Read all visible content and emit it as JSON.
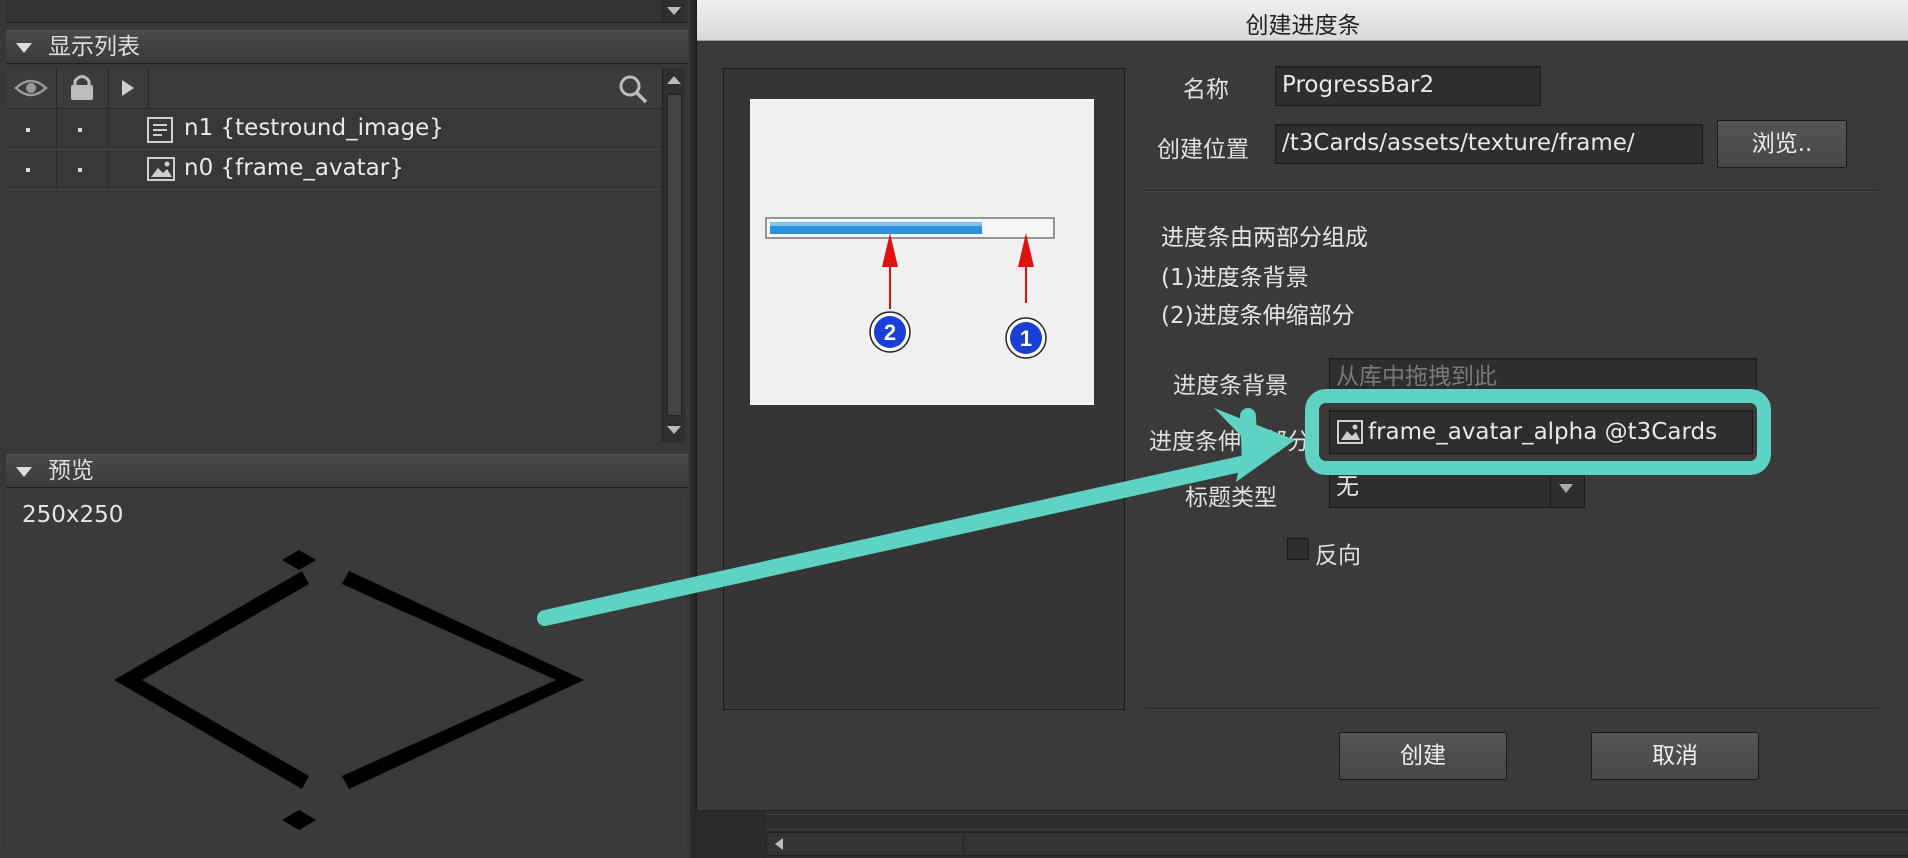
{
  "display_list": {
    "header": "显示列表",
    "rows": [
      {
        "name": "n1 {testround_image}",
        "icon": "text-icon"
      },
      {
        "name": "n0 {frame_avatar}",
        "icon": "image-icon"
      }
    ]
  },
  "preview_panel": {
    "header": "预览",
    "size_label": "250x250"
  },
  "dialog": {
    "title": "创建进度条",
    "name_label": "名称",
    "name_value": "ProgressBar2",
    "location_label": "创建位置",
    "location_value": "/t3Cards/assets/texture/frame/",
    "browse_button": "浏览..",
    "desc_line1": "进度条由两部分组成",
    "desc_line2": "(1)进度条背景",
    "desc_line3": "(2)进度条伸缩部分",
    "bg_label": "进度条背景",
    "bg_placeholder": "从库中拖拽到此",
    "stretch_label": "进度条伸缩部分",
    "stretch_value": "frame_avatar_alpha @t3Cards",
    "title_type_label": "标题类型",
    "title_type_value": "无",
    "reverse_label": "反向",
    "create_button": "创建",
    "cancel_button": "取消",
    "markers": [
      "1",
      "2"
    ]
  },
  "colors": {
    "highlight": "#5fd3c3",
    "progress_fill": "#2d8fd6",
    "arrow_red": "#e01010",
    "badge_blue": "#1a3fd6"
  }
}
